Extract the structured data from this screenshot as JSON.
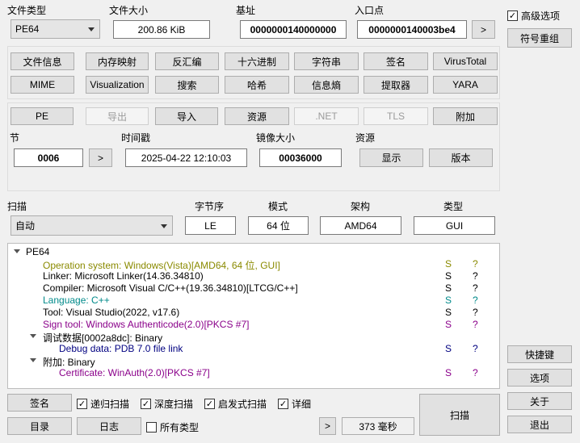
{
  "colors": {
    "olive": "#8a8a00",
    "teal": "#008a8a",
    "purple": "#8a008a",
    "navy": "#000080",
    "black": "#000000"
  },
  "header": {
    "file_type_label": "文件类型",
    "file_type_value": "PE64",
    "file_size_label": "文件大小",
    "file_size_value": "200.86 KiB",
    "base_label": "基址",
    "base_value": "0000000140000000",
    "entry_label": "入口点",
    "entry_value": "0000000140003be4",
    "entry_go": ">"
  },
  "right_panel": {
    "advanced_label": "高级选项",
    "advanced_checked": true,
    "symbol_reorg": "符号重组",
    "shortcuts": "快捷键",
    "options": "选项",
    "about": "关于",
    "exit": "退出"
  },
  "tools_row1": [
    "文件信息",
    "内存映射",
    "反汇编",
    "十六进制",
    "字符串",
    "签名",
    "VirusTotal"
  ],
  "tools_row2": [
    "MIME",
    "Visualization",
    "搜索",
    "哈希",
    "信息熵",
    "提取器",
    "YARA"
  ],
  "pe_tabs": {
    "pe": "PE",
    "export": "导出",
    "import": "导入",
    "resources": "资源",
    "net": ".NET",
    "tls": "TLS",
    "overlay": "附加"
  },
  "pe_info": {
    "section_label": "节",
    "section_value": "0006",
    "section_go": ">",
    "timestamp_label": "时间戳",
    "timestamp_value": "2025-04-22 12:10:03",
    "image_size_label": "镜像大小",
    "image_size_value": "00036000",
    "resources_label": "资源",
    "show_button": "显示",
    "version_button": "版本"
  },
  "scan": {
    "scan_label": "扫描",
    "scan_value": "自动",
    "endian_label": "字节序",
    "endian_value": "LE",
    "mode_label": "模式",
    "mode_value": "64 位",
    "arch_label": "架构",
    "arch_value": "AMD64",
    "type_label": "类型",
    "type_value": "GUI"
  },
  "results": {
    "root": "PE64",
    "items": [
      {
        "text": "Operation system: Windows(Vista)[AMD64, 64 位, GUI]",
        "s": "S",
        "q": "?"
      },
      {
        "text": "Linker: Microsoft Linker(14.36.34810)",
        "s": "S",
        "q": "?"
      },
      {
        "text": "Compiler: Microsoft Visual C/C++(19.36.34810)[LTCG/C++]",
        "s": "S",
        "q": "?"
      },
      {
        "text": "Language: C++",
        "s": "S",
        "q": "?"
      },
      {
        "text": "Tool: Visual Studio(2022, v17.6)",
        "s": "S",
        "q": "?"
      },
      {
        "text": "Sign tool: Windows Authenticode(2.0)[PKCS #7]",
        "s": "S",
        "q": "?"
      },
      {
        "text": "调试数据[0002a8dc]: Binary"
      },
      {
        "text": "Debug data: PDB 7.0 file link",
        "s": "S",
        "q": "?"
      },
      {
        "text": "附加: Binary"
      },
      {
        "text": "Certificate: WinAuth(2.0)[PKCS #7]",
        "s": "S",
        "q": "?"
      }
    ]
  },
  "bottom": {
    "signature": "签名",
    "recursive": "递归扫描",
    "deep": "深度扫描",
    "heuristic": "启发式扫描",
    "verbose": "详细",
    "directory": "目录",
    "log": "日志",
    "all_types": "所有类型",
    "more": ">",
    "elapsed": "373 毫秒",
    "scan_button": "扫描"
  }
}
